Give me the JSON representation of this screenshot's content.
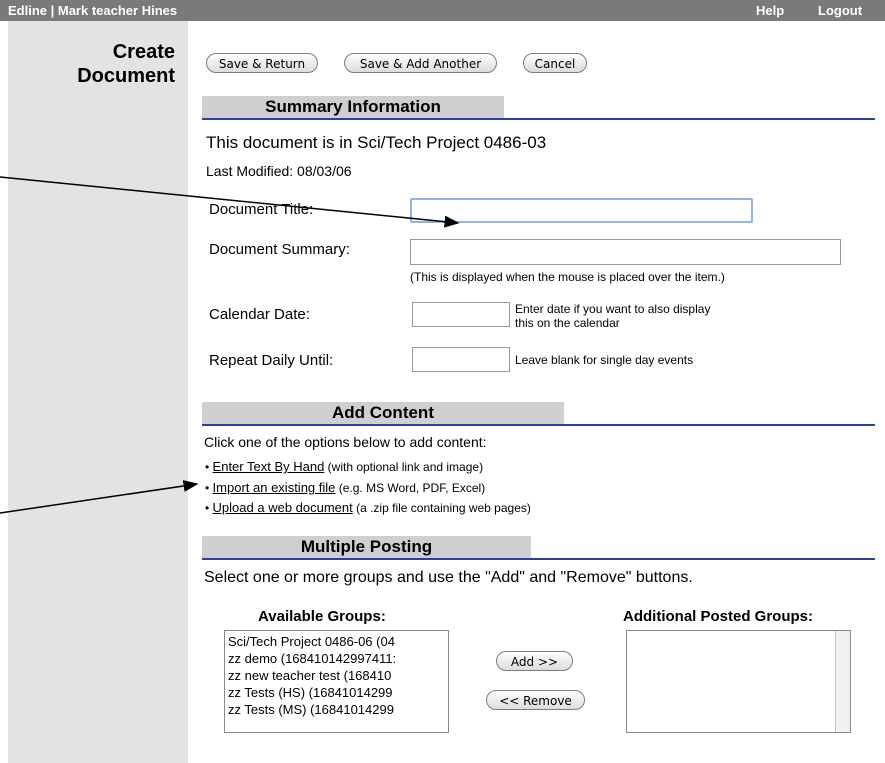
{
  "topbar": {
    "brand": "Edline | Mark teacher Hines",
    "help": "Help",
    "logout": "Logout"
  },
  "page_title_line1": "Create",
  "page_title_line2": "Document",
  "actions": {
    "save_return": "Save & Return",
    "save_add": "Save & Add Another",
    "cancel": "Cancel"
  },
  "summary": {
    "header": "Summary Information",
    "location": "This document is in Sci/Tech Project 0486-03",
    "last_modified": "Last Modified: 08/03/06",
    "title_label": "Document Title:",
    "title_value": "",
    "summary_label": "Document Summary:",
    "summary_value": "",
    "summary_hint": "(This is displayed when the mouse is placed over the item.)",
    "calendar_label": "Calendar Date:",
    "calendar_value": "",
    "calendar_hint_line1": "Enter date if you want to also display",
    "calendar_hint_line2": "this on the calendar",
    "repeat_label": "Repeat Daily Until:",
    "repeat_value": "",
    "repeat_hint": "Leave blank for single day events"
  },
  "content": {
    "header": "Add Content",
    "intro": "Click one of the options below to add content:",
    "options": [
      {
        "link": "Enter Text By Hand",
        "note": "(with optional link and image)"
      },
      {
        "link": "Import an existing file",
        "note": "(e.g. MS Word, PDF, Excel)"
      },
      {
        "link": "Upload a web document",
        "note": "(a .zip file containing web pages)"
      }
    ]
  },
  "posting": {
    "header": "Multiple Posting",
    "intro": "Select one or more groups and use the \"Add\" and \"Remove\" buttons.",
    "available_label": "Available Groups:",
    "posted_label": "Additional Posted Groups:",
    "available_groups": [
      "Sci/Tech Project 0486-06 (04",
      "zz demo (168410142997411:",
      "zz new teacher test (168410",
      "zz Tests (HS) (16841014299",
      "zz Tests (MS) (16841014299"
    ],
    "add_label": "Add >>",
    "remove_label": "<< Remove"
  }
}
